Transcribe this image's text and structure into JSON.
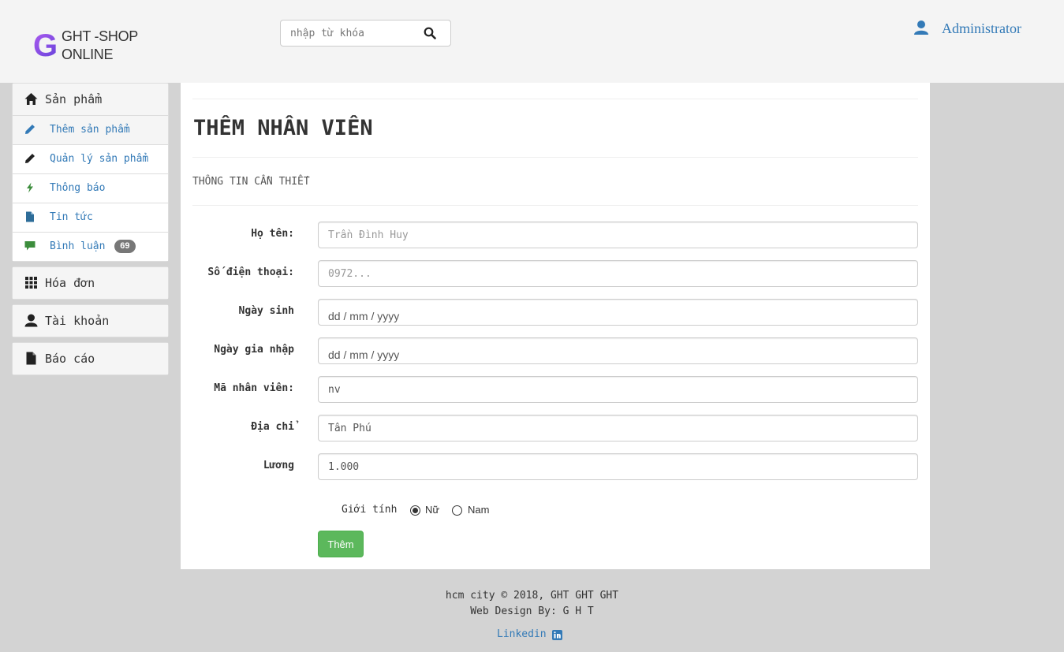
{
  "header": {
    "logo_letter": "G",
    "logo_line1": "GHT -SHOP",
    "logo_line2": "ONLINE",
    "search_placeholder": "nhập từ khóa",
    "user_name": "Administrator"
  },
  "sidebar": {
    "products_label": "Sản phẩm",
    "items": [
      {
        "label": "Thêm sản phẩm",
        "icon": "pencil-icon"
      },
      {
        "label": "Quản lý sản phẩm",
        "icon": "pencil-icon"
      },
      {
        "label": "Thông báo",
        "icon": "flash-icon"
      },
      {
        "label": "Tin tức",
        "icon": "file-icon"
      },
      {
        "label": "Bình luận",
        "icon": "comment-icon",
        "badge": "69"
      }
    ],
    "invoices_label": "Hóa đơn",
    "account_label": "Tài khoản",
    "reports_label": "Báo cáo"
  },
  "form": {
    "title": "THÊM NHÂN VIÊN",
    "section": "THÔNG TIN CẦN THIẾT",
    "fields": [
      {
        "label": "Họ tên:",
        "value": "",
        "placeholder": "Trần Đình Huy"
      },
      {
        "label": "Số điện thoại:",
        "value": "",
        "placeholder": "0972..."
      },
      {
        "label": "Ngày sinh",
        "value": "",
        "placeholder": "dd / mm / yyyy"
      },
      {
        "label": "Ngày gia nhập",
        "value": "",
        "placeholder": "dd / mm / yyyy"
      },
      {
        "label": "Mã nhân viên:",
        "value": "nv",
        "placeholder": ""
      },
      {
        "label": "Địa chỉ",
        "value": "Tân Phú",
        "placeholder": ""
      },
      {
        "label": "Lương",
        "value": "1.000",
        "placeholder": ""
      }
    ],
    "gender_label": "Giới tính",
    "gender_female": "Nữ",
    "gender_male": "Nam",
    "submit_label": "Thêm"
  },
  "footer": {
    "line1": "hcm city © 2018, GHT GHT GHT",
    "line2": "Web Design By: G H T",
    "link": "Linkedin"
  },
  "colors": {
    "link": "#337ab7",
    "success": "#5cb85c",
    "page_bg": "#d3d3d3",
    "header_bg": "#f4f4f4"
  }
}
